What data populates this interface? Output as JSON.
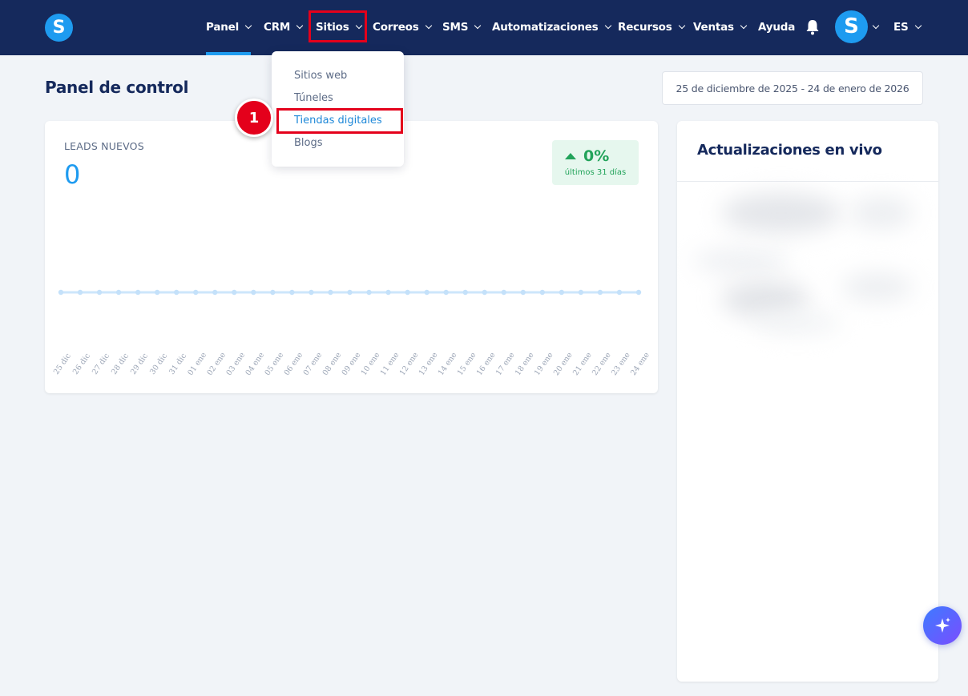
{
  "nav": {
    "logo_letter": "S",
    "items": [
      {
        "label": "Panel",
        "chevron": true
      },
      {
        "label": "CRM",
        "chevron": true
      },
      {
        "label": "Sitios",
        "chevron": true
      },
      {
        "label": "Correos",
        "chevron": true
      },
      {
        "label": "SMS",
        "chevron": true
      },
      {
        "label": "Automatizaciones",
        "chevron": true
      },
      {
        "label": "Recursos",
        "chevron": true
      },
      {
        "label": "Ventas",
        "chevron": true
      },
      {
        "label": "Ayuda",
        "chevron": false
      }
    ],
    "avatar_letter": "S",
    "language": "ES"
  },
  "page": {
    "title": "Panel de control",
    "date_range": "25 de diciembre de 2025 - 24 de enero de 2026"
  },
  "leads_card": {
    "label": "LEADS NUEVOS",
    "value": "0",
    "trend_value": "0%",
    "trend_period": "últimos 31 días"
  },
  "chart_data": {
    "type": "line",
    "categories": [
      "25 dic",
      "26 dic",
      "27 dic",
      "28 dic",
      "29 dic",
      "30 dic",
      "31 dic",
      "01 ene",
      "02 ene",
      "03 ene",
      "04 ene",
      "05 ene",
      "06 ene",
      "07 ene",
      "08 ene",
      "09 ene",
      "10 ene",
      "11 ene",
      "12 ene",
      "13 ene",
      "14 ene",
      "15 ene",
      "16 ene",
      "17 ene",
      "18 ene",
      "19 ene",
      "20 ene",
      "21 ene",
      "22 ene",
      "23 ene",
      "24 ene"
    ],
    "values": [
      0,
      0,
      0,
      0,
      0,
      0,
      0,
      0,
      0,
      0,
      0,
      0,
      0,
      0,
      0,
      0,
      0,
      0,
      0,
      0,
      0,
      0,
      0,
      0,
      0,
      0,
      0,
      0,
      0,
      0,
      0
    ],
    "ylim": [
      -1,
      1
    ],
    "grid": false
  },
  "live_card": {
    "title": "Actualizaciones en vivo"
  },
  "dropdown": {
    "items": [
      "Sitios web",
      "Túneles",
      "Tiendas digitales",
      "Blogs"
    ],
    "selected": "Tiendas digitales"
  },
  "annotation": {
    "step": "1"
  },
  "colors": {
    "nav_bg": "#15295c",
    "accent": "#1e9bf0",
    "highlight": "#e4001b",
    "positive": "#22a35a"
  }
}
